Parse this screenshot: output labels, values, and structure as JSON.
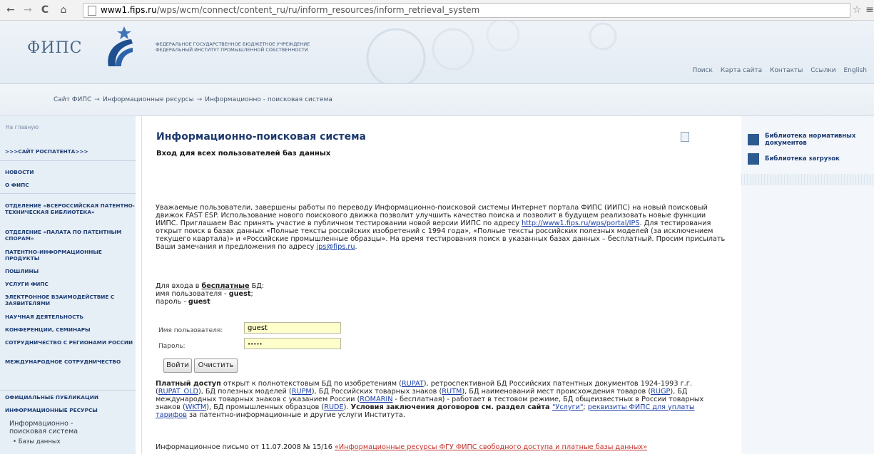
{
  "browser": {
    "url_host": "www1.fips.ru",
    "url_path": "/wps/wcm/connect/content_ru/ru/inform_resources/inform_retrieval_system",
    "back_icon": "←",
    "forward_icon": "→",
    "reload_icon": "C",
    "home_icon": "⌂",
    "star_icon": "☆",
    "menu_icon": "≡"
  },
  "header": {
    "logo_text": "ФИПС",
    "org_line1": "ФЕДЕРАЛЬНОЕ ГОСУДАРСТВЕННОЕ БЮДЖЕТНОЕ УЧРЕЖДЕНИЕ",
    "org_line2": "ФЕДЕРАЛЬНЫЙ ИНСТИТУТ ПРОМЫШЛЕННОЙ СОБСТВЕННОСТИ",
    "links": [
      "Поиск",
      "Карта сайта",
      "Контакты",
      "Ссылки",
      "English"
    ]
  },
  "breadcrumbs": {
    "items": [
      "Сайт ФИПС",
      "Информационные ресурсы",
      "Информационно - поисковая система"
    ],
    "separator": "→"
  },
  "left_nav": {
    "home": "На главную",
    "items": [
      ">>>САЙТ РОСПАТЕНТА>>>",
      "НОВОСТИ",
      "О ФИПС",
      "ОТДЕЛЕНИЕ «ВСЕРОССИЙСКАЯ ПАТЕНТНО-ТЕХНИЧЕСКАЯ БИБЛИОТЕКА»",
      "ОТДЕЛЕНИЕ «ПАЛАТА ПО ПАТЕНТНЫМ СПОРАМ»",
      "ПАТЕНТНО-ИНФОРМАЦИОННЫЕ ПРОДУКТЫ",
      "ПОШЛИНЫ",
      "УСЛУГИ ФИПС",
      "ЭЛЕКТРОННОЕ ВЗАИМОДЕЙСТВИЕ С ЗАЯВИТЕЛЯМИ",
      "НАУЧНАЯ ДЕЯТЕЛЬНОСТЬ",
      "КОНФЕРЕНЦИИ, СЕМИНАРЫ",
      "СОТРУДНИЧЕСТВО С РЕГИОНАМИ РОССИИ",
      "МЕЖДУНАРОДНОЕ СОТРУДНИЧЕСТВО",
      "ОФИЦИАЛЬНЫЕ ПУБЛИКАЦИИ",
      "ИНФОРМАЦИОННЫЕ РЕСУРСЫ"
    ],
    "sub_current": "Информационно - поисковая система",
    "sub_child": "• Базы данных"
  },
  "main": {
    "title": "Информационно-поисковая система",
    "subtitle": "Вход для всех пользователей баз данных",
    "intro_before_link": "Уважаемые пользователи, завершены работы по переводу Информационно-поисковой системы Интернет портала ФИПС (ИИПС) на новый поисковый движок FAST ESP. Использование нового поискового движка позволит улучшить качество поиска и позволит в будущем реализовать новые функции ИИПС. Приглашаем Вас принять участие в публичном тестировании новой версии ИИПС по адресу ",
    "intro_link": "http://www1.fips.ru/wps/portal/IPS",
    "intro_after_link": ". Для тестирования открыт поиск в базах данных «Полные тексты российских изобретений с 1994 года», «Полные тексты российских полезных моделей (за исключением текущего квартала)» и «Российские промышленные образцы». На время тестирования поиск в указанных базах данных – бесплатный. Просим присылать Ваши замечания и предложения по адресу ",
    "intro_email": "ips@fips.ru",
    "intro_end": ".",
    "free_prefix": "Для входа в ",
    "free_word": "бесплатные",
    "free_suffix": " БД:",
    "user_prefix": "имя пользователя - ",
    "user_value": "guest",
    "user_suffix": ";",
    "pass_prefix": "пароль  - ",
    "pass_value": "guest",
    "form": {
      "username_label": "Имя пользователя:",
      "username_value": "guest",
      "password_label": "Пароль:",
      "password_value": "•••••",
      "login_button": "Войти",
      "clear_button": "Очистить"
    },
    "paid": {
      "lead": "Платный доступ",
      "t1": " открыт к полнотекстовым БД по изобретениям (",
      "l1": "RUPAT",
      "t2": "), ретроспективной БД Российских патентных документов 1924-1993 г.г. (",
      "l2": "RUPAT_OLD",
      "t3": "), БД полезных моделей (",
      "l3": "RUPM",
      "t4": "), БД Российских товарных знаков (",
      "l4": "RUTM",
      "t5": "),  БД наименований мест происхождения товаров (",
      "l5": "RUGP",
      "t6": "), БД международных товарных знаков с указанием России (",
      "l6": "ROMARIN",
      "t7": " - бесплатная) - работает в тестовом режиме, БД общеизвестных в России товарных знаков (",
      "l7": "WKTM",
      "t8": "), БД промышленных образцов (",
      "l8": "RUDE",
      "t9": "). ",
      "b1": "Условия заключения договоров см. раздел сайта ",
      "l9": "\"Услуги\"",
      "t10": "; ",
      "l10": "реквизиты ФИПС для уплаты тарифов",
      "t11": " за патентно-информационные и другие услуги Института."
    },
    "letter_text": "Информационное письмо от 11.07.2008 № 15/16 ",
    "letter_link": "«Информационные ресурсы ФГУ ФИПС свободного доступа и платные базы данных»"
  },
  "right_col": {
    "link1": "Библиотека нормативных документов",
    "link2": "Библиотека загрузок"
  }
}
